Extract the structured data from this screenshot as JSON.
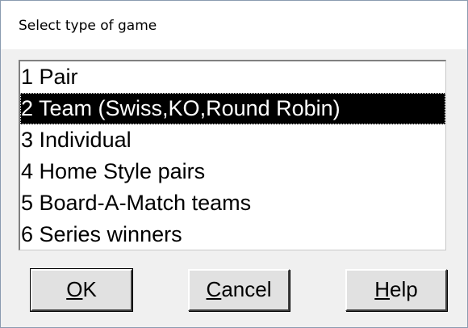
{
  "dialog": {
    "title": "Select type of game"
  },
  "game_types": {
    "items": [
      {
        "label": "1 Pair"
      },
      {
        "label": "2 Team (Swiss,KO,Round Robin)",
        "selected": true
      },
      {
        "label": "3 Individual"
      },
      {
        "label": "4 Home Style pairs"
      },
      {
        "label": "5 Board-A-Match teams"
      },
      {
        "label": "6 Series winners"
      }
    ],
    "selected_index": 1
  },
  "buttons": {
    "ok": {
      "accel": "O",
      "rest": "K"
    },
    "cancel": {
      "accel": "C",
      "rest": "ancel"
    },
    "help": {
      "accel": "H",
      "rest": "elp"
    }
  },
  "colors": {
    "dialog_bg": "#f0f0f0",
    "selection_bg": "#000000",
    "selection_fg": "#ffffff"
  }
}
